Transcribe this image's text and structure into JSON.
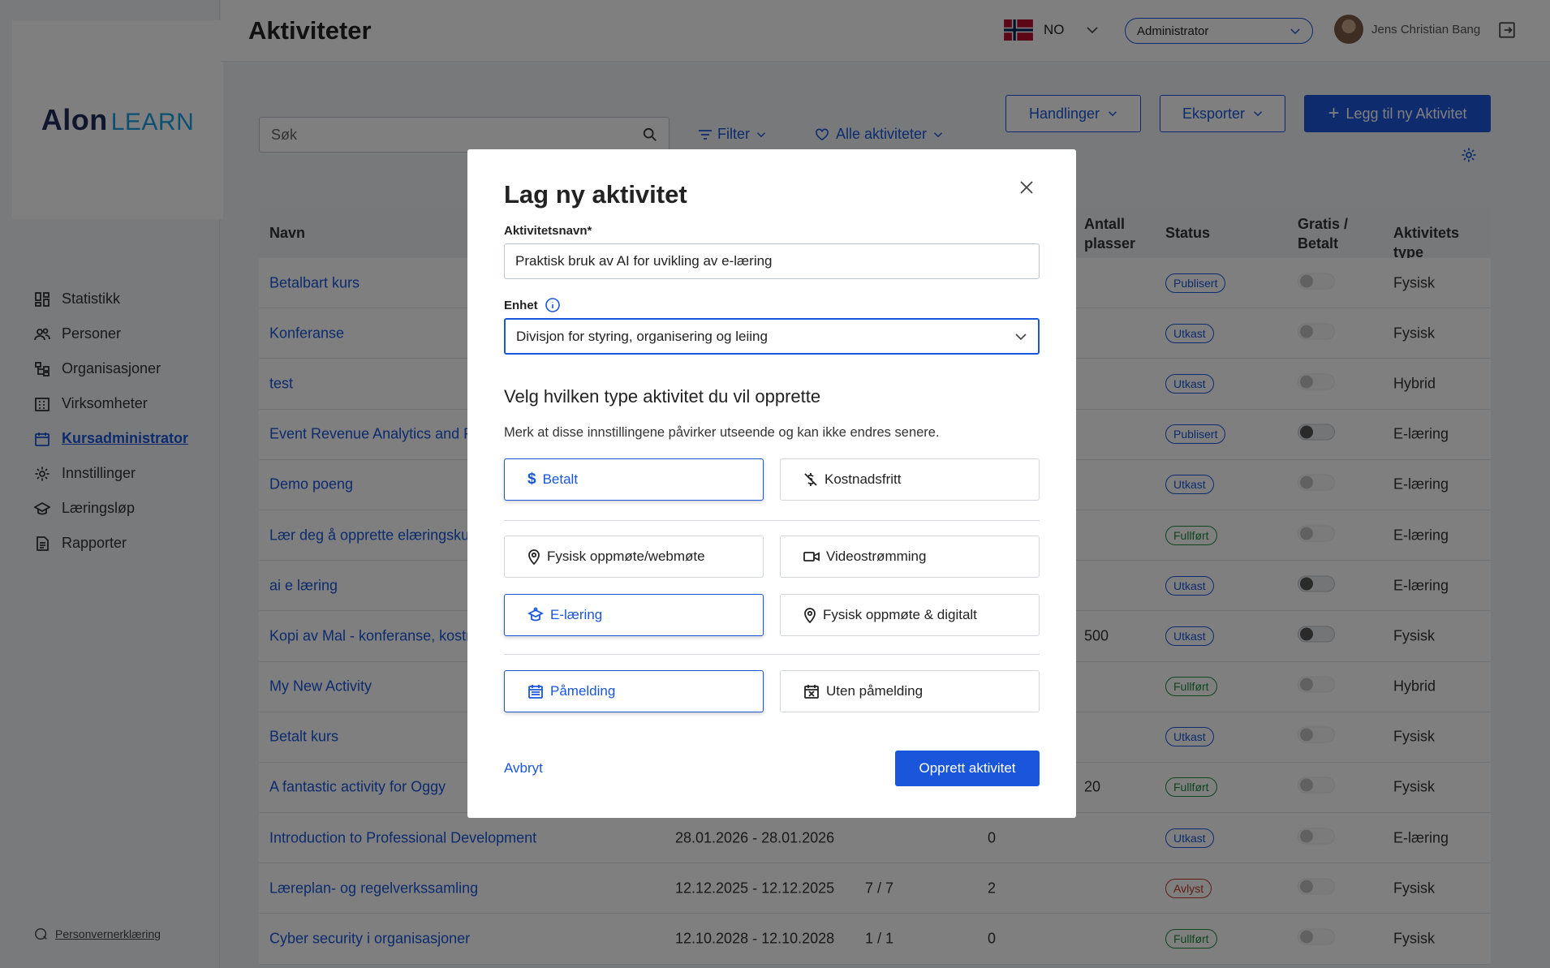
{
  "app": {
    "logo_main": "Alon",
    "logo_sub": "LEARN",
    "page_title": "Aktiviteter"
  },
  "header": {
    "language": "NO",
    "role": "Administrator",
    "user_name": "Jens Christian Bang"
  },
  "sidebar": {
    "items": [
      {
        "label": "Statistikk",
        "icon": "grid-icon"
      },
      {
        "label": "Personer",
        "icon": "users-icon"
      },
      {
        "label": "Organisasjoner",
        "icon": "org-icon"
      },
      {
        "label": "Virksomheter",
        "icon": "building-icon"
      },
      {
        "label": "Kursadministrator",
        "icon": "calendar-icon",
        "active": true
      },
      {
        "label": "Innstillinger",
        "icon": "gear-icon"
      },
      {
        "label": "Læringsløp",
        "icon": "graduation-icon"
      },
      {
        "label": "Rapporter",
        "icon": "report-icon"
      }
    ],
    "privacy": "Personvernerklæring"
  },
  "toolbar": {
    "search_placeholder": "Søk",
    "filter_label": "Filter",
    "all_activities_label": "Alle aktiviteter",
    "actions_label": "Handlinger",
    "export_label": "Eksporter",
    "add_label": "Legg til ny Aktivitet"
  },
  "table": {
    "headers": {
      "name": "Navn",
      "places_1": "Antall",
      "places_2": "plasser",
      "status": "Status",
      "paid_1": "Gratis /",
      "paid_2": "Betalt",
      "type": "Aktivitets type"
    },
    "rows": [
      {
        "name": "Betalbart kurs",
        "date": "",
        "count": "",
        "num": "",
        "places": "",
        "status": "Publisert",
        "toggle": "dim",
        "type": "Fysisk"
      },
      {
        "name": "Konferanse",
        "date": "",
        "count": "",
        "num": "",
        "places": "",
        "status": "Utkast",
        "toggle": "dim",
        "type": "Fysisk"
      },
      {
        "name": "test",
        "date": "",
        "count": "",
        "num": "",
        "places": "",
        "status": "Utkast",
        "toggle": "dim",
        "type": "Hybrid"
      },
      {
        "name": "Event Revenue Analytics and Fi",
        "date": "",
        "count": "",
        "num": "",
        "places": "",
        "status": "Publisert",
        "toggle": "on",
        "type": "E-læring"
      },
      {
        "name": "Demo poeng",
        "date": "",
        "count": "",
        "num": "",
        "places": "",
        "status": "Utkast",
        "toggle": "dim",
        "type": "E-læring"
      },
      {
        "name": "Lær deg å opprette elæringskur",
        "date": "",
        "count": "",
        "num": "",
        "places": "",
        "status": "Fullført",
        "toggle": "dim",
        "type": "E-læring"
      },
      {
        "name": "ai e læring",
        "date": "",
        "count": "",
        "num": "",
        "places": "",
        "status": "Utkast",
        "toggle": "on",
        "type": "E-læring"
      },
      {
        "name": "Kopi av Mal - konferanse, kostn",
        "date": "",
        "count": "",
        "num": "",
        "places": "500",
        "status": "Utkast",
        "toggle": "on",
        "type": "Fysisk"
      },
      {
        "name": "My New Activity",
        "date": "",
        "count": "",
        "num": "",
        "places": "",
        "status": "Fullført",
        "toggle": "dim",
        "type": "Hybrid"
      },
      {
        "name": "Betalt kurs",
        "date": "",
        "count": "",
        "num": "",
        "places": "",
        "status": "Utkast",
        "toggle": "dim",
        "type": "Fysisk"
      },
      {
        "name": "A fantastic activity for Oggy",
        "date": "",
        "count": "",
        "num": "",
        "places": "20",
        "status": "Fullført",
        "toggle": "dim",
        "type": "Fysisk"
      },
      {
        "name": "Introduction to Professional Development",
        "date": "28.01.2026 - 28.01.2026",
        "count": "",
        "num": "0",
        "places": "",
        "status": "Utkast",
        "toggle": "dim",
        "type": "E-læring"
      },
      {
        "name": "Læreplan- og regelverkssamling",
        "date": "12.12.2025 - 12.12.2025",
        "count": "7 / 7",
        "num": "2",
        "places": "",
        "status": "Avlyst",
        "toggle": "dim",
        "type": "Fysisk"
      },
      {
        "name": "Cyber security i organisasjoner",
        "date": "12.10.2028 - 12.10.2028",
        "count": "1 / 1",
        "num": "0",
        "places": "",
        "status": "Fullført",
        "toggle": "dim",
        "type": "Fysisk"
      }
    ]
  },
  "status_colors": {
    "Publisert": "#1a56db",
    "Utkast": "#1a56db",
    "Fullført": "#1e8a3c",
    "Avlyst": "#c0392b"
  },
  "modal": {
    "title": "Lag ny aktivitet",
    "name_label": "Aktivitetsnavn*",
    "name_value": "Praktisk bruk av AI for uvikling av e-læring",
    "unit_label": "Enhet",
    "unit_value": "Divisjon for styring, organisering og leiing",
    "type_heading": "Velg hvilken type aktivitet du vil opprette",
    "type_note": "Merk at disse innstillingene påvirker utseende og kan ikke endres senere.",
    "options": {
      "paid": "Betalt",
      "free": "Kostnadsfritt",
      "physical_web": "Fysisk oppmøte/webmøte",
      "video": "Videostrømming",
      "elearning": "E-læring",
      "physical_digital": "Fysisk oppmøte & digitalt",
      "registration": "Påmelding",
      "no_registration": "Uten påmelding"
    },
    "cancel_label": "Avbryt",
    "create_label": "Opprett aktivitet"
  },
  "colors": {
    "accent": "#1a56db",
    "brand_light": "#1ba1e2",
    "brand_dark": "#1f2d5c"
  }
}
